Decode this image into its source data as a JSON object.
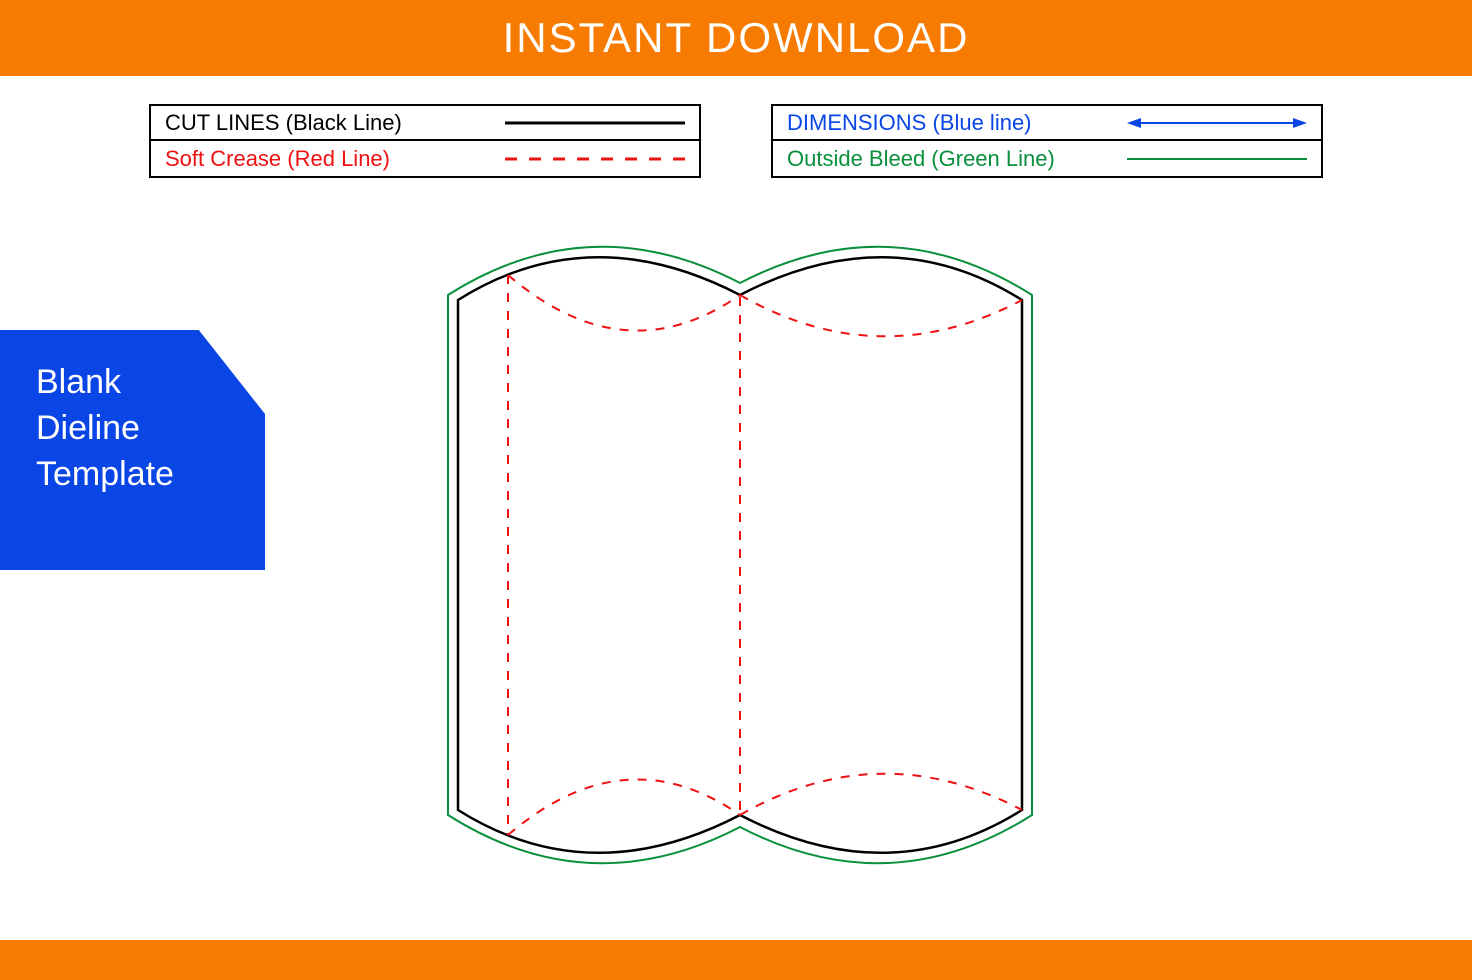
{
  "banner": {
    "title": "INSTANT DOWNLOAD"
  },
  "legend": {
    "left": {
      "row1": {
        "label": "CUT LINES (Black Line)",
        "color": "#000000"
      },
      "row2": {
        "label": "Soft Crease (Red Line)",
        "color": "#e11"
      }
    },
    "right": {
      "row1": {
        "label": "DIMENSIONS (Blue line)",
        "color": "#0a46e6"
      },
      "row2": {
        "label": "Outside Bleed (Green Line)",
        "color": "#0a8f3c"
      }
    }
  },
  "side": {
    "line1": "Blank",
    "line2": "Dieline",
    "line3": "Template"
  },
  "colors": {
    "orange": "#f77b00",
    "blue": "#0a46e6",
    "red": "#e11",
    "green": "#0a8f3c",
    "black": "#000000"
  }
}
